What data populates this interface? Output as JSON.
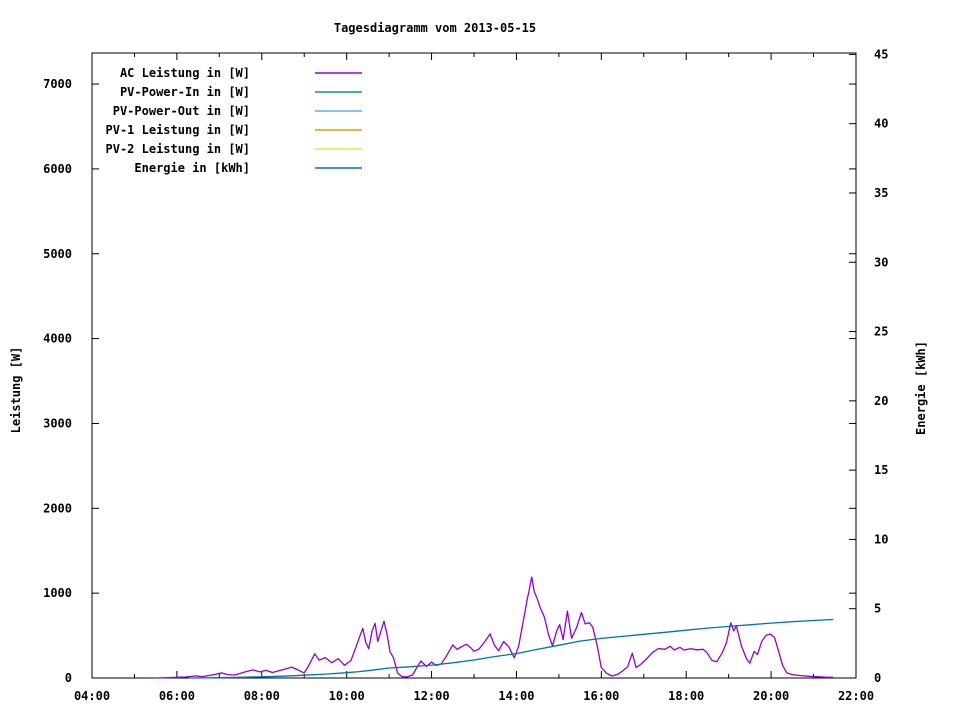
{
  "chart_data": {
    "type": "line",
    "title": "Tagesdiagramm vom 2013-05-15",
    "grid": false,
    "legend_position": "inside-top-left",
    "x_axis": {
      "kind": "time",
      "min_hour": 4,
      "max_hour": 22,
      "minor_tick_every_hours": 1,
      "ticks": [
        {
          "h": 4,
          "label": "04:00"
        },
        {
          "h": 6,
          "label": "06:00"
        },
        {
          "h": 8,
          "label": "08:00"
        },
        {
          "h": 10,
          "label": "10:00"
        },
        {
          "h": 12,
          "label": "12:00"
        },
        {
          "h": 14,
          "label": "14:00"
        },
        {
          "h": 16,
          "label": "16:00"
        },
        {
          "h": 18,
          "label": "18:00"
        },
        {
          "h": 20,
          "label": "20:00"
        },
        {
          "h": 22,
          "label": "22:00"
        }
      ]
    },
    "y1_axis": {
      "title": "Leistung [W]",
      "min": 0,
      "max": 7366,
      "ticks": [
        {
          "v": 0,
          "label": "0"
        },
        {
          "v": 1000,
          "label": "1000"
        },
        {
          "v": 2000,
          "label": "2000"
        },
        {
          "v": 3000,
          "label": "3000"
        },
        {
          "v": 4000,
          "label": "4000"
        },
        {
          "v": 5000,
          "label": "5000"
        },
        {
          "v": 6000,
          "label": "6000"
        },
        {
          "v": 7000,
          "label": "7000"
        }
      ]
    },
    "y2_axis": {
      "title": "Energie [kWh]",
      "min": 0,
      "max": 45.1,
      "ticks": [
        {
          "v": 0,
          "label": "0"
        },
        {
          "v": 5,
          "label": "5"
        },
        {
          "v": 10,
          "label": "10"
        },
        {
          "v": 15,
          "label": "15"
        },
        {
          "v": 20,
          "label": "20"
        },
        {
          "v": 25,
          "label": "25"
        },
        {
          "v": 30,
          "label": "30"
        },
        {
          "v": 35,
          "label": "35"
        },
        {
          "v": 40,
          "label": "40"
        },
        {
          "v": 45,
          "label": "45"
        }
      ]
    },
    "legend": [
      {
        "label": "AC Leistung in [W]",
        "color": "#9400d3"
      },
      {
        "label": "PV-Power-In in [W]",
        "color": "#009e73"
      },
      {
        "label": "PV-Power-Out in [W]",
        "color": "#56b4e9"
      },
      {
        "label": "PV-1 Leistung in [W]",
        "color": "#e69f00"
      },
      {
        "label": "PV-2 Leistung in [W]",
        "color": "#f0e442"
      },
      {
        "label": "Energie in [kWh]",
        "color": "#0072b2"
      }
    ],
    "series": [
      {
        "name": "AC Leistung in [W]",
        "color": "#9400d3",
        "axis": "y1",
        "points": [
          [
            5.5,
            0
          ],
          [
            5.8,
            5
          ],
          [
            6.0,
            8
          ],
          [
            6.2,
            12
          ],
          [
            6.45,
            25
          ],
          [
            6.6,
            15
          ],
          [
            6.75,
            30
          ],
          [
            6.9,
            42
          ],
          [
            7.05,
            60
          ],
          [
            7.2,
            40
          ],
          [
            7.35,
            35
          ],
          [
            7.5,
            55
          ],
          [
            7.65,
            78
          ],
          [
            7.8,
            95
          ],
          [
            7.95,
            72
          ],
          [
            8.1,
            90
          ],
          [
            8.25,
            65
          ],
          [
            8.4,
            85
          ],
          [
            8.55,
            105
          ],
          [
            8.7,
            128
          ],
          [
            8.85,
            95
          ],
          [
            9.0,
            60
          ],
          [
            9.1,
            140
          ],
          [
            9.25,
            285
          ],
          [
            9.35,
            210
          ],
          [
            9.5,
            240
          ],
          [
            9.65,
            180
          ],
          [
            9.8,
            228
          ],
          [
            9.95,
            150
          ],
          [
            10.1,
            205
          ],
          [
            10.2,
            340
          ],
          [
            10.3,
            480
          ],
          [
            10.38,
            585
          ],
          [
            10.45,
            420
          ],
          [
            10.52,
            345
          ],
          [
            10.6,
            555
          ],
          [
            10.67,
            645
          ],
          [
            10.73,
            430
          ],
          [
            10.8,
            540
          ],
          [
            10.88,
            670
          ],
          [
            10.95,
            515
          ],
          [
            11.02,
            310
          ],
          [
            11.1,
            240
          ],
          [
            11.2,
            60
          ],
          [
            11.3,
            18
          ],
          [
            11.42,
            12
          ],
          [
            11.55,
            35
          ],
          [
            11.65,
            120
          ],
          [
            11.75,
            200
          ],
          [
            11.88,
            135
          ],
          [
            12.0,
            188
          ],
          [
            12.1,
            148
          ],
          [
            12.22,
            162
          ],
          [
            12.35,
            258
          ],
          [
            12.5,
            390
          ],
          [
            12.6,
            338
          ],
          [
            12.72,
            372
          ],
          [
            12.82,
            398
          ],
          [
            12.92,
            358
          ],
          [
            13.0,
            315
          ],
          [
            13.12,
            342
          ],
          [
            13.25,
            425
          ],
          [
            13.38,
            520
          ],
          [
            13.48,
            388
          ],
          [
            13.58,
            320
          ],
          [
            13.7,
            430
          ],
          [
            13.82,
            368
          ],
          [
            13.95,
            238
          ],
          [
            14.05,
            372
          ],
          [
            14.15,
            640
          ],
          [
            14.25,
            920
          ],
          [
            14.31,
            1060
          ],
          [
            14.36,
            1190
          ],
          [
            14.42,
            1015
          ],
          [
            14.48,
            948
          ],
          [
            14.57,
            818
          ],
          [
            14.66,
            715
          ],
          [
            14.75,
            520
          ],
          [
            14.85,
            378
          ],
          [
            14.95,
            558
          ],
          [
            15.02,
            628
          ],
          [
            15.1,
            452
          ],
          [
            15.2,
            788
          ],
          [
            15.3,
            468
          ],
          [
            15.42,
            598
          ],
          [
            15.53,
            772
          ],
          [
            15.62,
            638
          ],
          [
            15.72,
            652
          ],
          [
            15.8,
            598
          ],
          [
            15.9,
            388
          ],
          [
            16.0,
            122
          ],
          [
            16.12,
            58
          ],
          [
            16.25,
            24
          ],
          [
            16.38,
            42
          ],
          [
            16.5,
            82
          ],
          [
            16.62,
            132
          ],
          [
            16.73,
            292
          ],
          [
            16.82,
            122
          ],
          [
            16.92,
            158
          ],
          [
            17.05,
            218
          ],
          [
            17.2,
            298
          ],
          [
            17.35,
            348
          ],
          [
            17.5,
            338
          ],
          [
            17.62,
            374
          ],
          [
            17.72,
            330
          ],
          [
            17.85,
            362
          ],
          [
            17.95,
            330
          ],
          [
            18.1,
            345
          ],
          [
            18.25,
            332
          ],
          [
            18.4,
            338
          ],
          [
            18.5,
            292
          ],
          [
            18.6,
            210
          ],
          [
            18.72,
            192
          ],
          [
            18.85,
            298
          ],
          [
            18.95,
            418
          ],
          [
            19.05,
            650
          ],
          [
            19.12,
            555
          ],
          [
            19.18,
            618
          ],
          [
            19.3,
            378
          ],
          [
            19.42,
            228
          ],
          [
            19.5,
            175
          ],
          [
            19.6,
            312
          ],
          [
            19.68,
            278
          ],
          [
            19.78,
            432
          ],
          [
            19.88,
            502
          ],
          [
            19.98,
            518
          ],
          [
            20.08,
            478
          ],
          [
            20.17,
            328
          ],
          [
            20.27,
            148
          ],
          [
            20.37,
            60
          ],
          [
            20.5,
            40
          ],
          [
            20.7,
            28
          ],
          [
            20.9,
            20
          ],
          [
            21.1,
            14
          ],
          [
            21.3,
            10
          ],
          [
            21.45,
            8
          ]
        ]
      },
      {
        "name": "PV-Power-In in [W]",
        "color": "#009e73",
        "axis": "y1",
        "points": []
      },
      {
        "name": "PV-Power-Out in [W]",
        "color": "#56b4e9",
        "axis": "y1",
        "points": []
      },
      {
        "name": "PV-1 Leistung in [W]",
        "color": "#e69f00",
        "axis": "y1",
        "points": []
      },
      {
        "name": "PV-2 Leistung in [W]",
        "color": "#f0e442",
        "axis": "y1",
        "points": []
      },
      {
        "name": "Energie in [kWh]",
        "color": "#0072b2",
        "axis": "y2",
        "points": [
          [
            6.3,
            0.0
          ],
          [
            7.0,
            0.02
          ],
          [
            7.5,
            0.05
          ],
          [
            8.0,
            0.09
          ],
          [
            8.5,
            0.13
          ],
          [
            9.0,
            0.2
          ],
          [
            9.5,
            0.28
          ],
          [
            10.0,
            0.38
          ],
          [
            10.3,
            0.46
          ],
          [
            10.6,
            0.56
          ],
          [
            11.0,
            0.72
          ],
          [
            11.5,
            0.81
          ],
          [
            12.0,
            0.93
          ],
          [
            12.5,
            1.1
          ],
          [
            13.0,
            1.3
          ],
          [
            13.5,
            1.55
          ],
          [
            14.0,
            1.76
          ],
          [
            14.5,
            2.07
          ],
          [
            15.0,
            2.36
          ],
          [
            15.5,
            2.66
          ],
          [
            16.0,
            2.86
          ],
          [
            16.5,
            3.0
          ],
          [
            17.0,
            3.15
          ],
          [
            17.5,
            3.3
          ],
          [
            18.0,
            3.45
          ],
          [
            18.5,
            3.6
          ],
          [
            19.0,
            3.72
          ],
          [
            19.5,
            3.84
          ],
          [
            20.0,
            3.96
          ],
          [
            20.5,
            4.06
          ],
          [
            21.0,
            4.15
          ],
          [
            21.45,
            4.22
          ]
        ]
      }
    ]
  }
}
